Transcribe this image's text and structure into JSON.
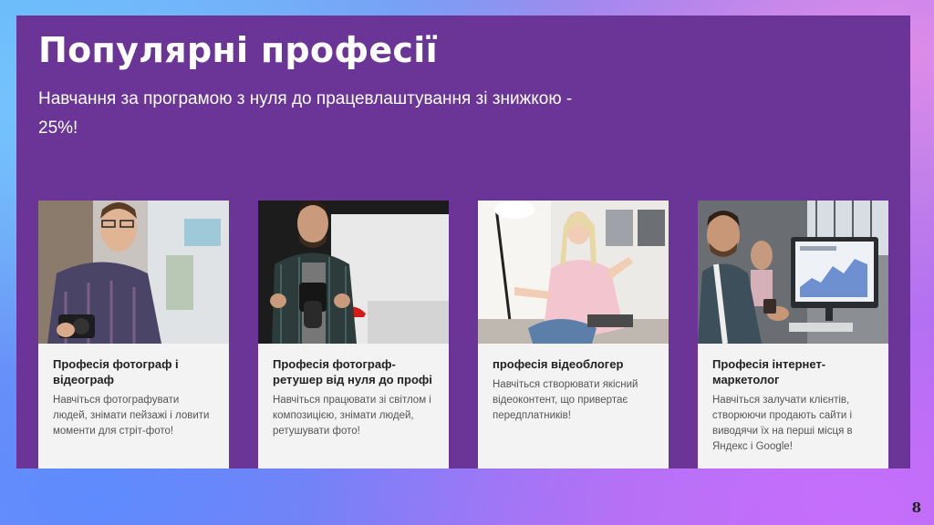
{
  "slide": {
    "title": "Популярні професії",
    "subtitle": "Навчання за програмою з нуля до працевлаштування зі знижкою - 25%!",
    "page_number": "8"
  },
  "cards": [
    {
      "title": "Професія фотограф і відеограф",
      "text": "Навчіться фотографувати людей, знімати пейзажі і ловити моменти для стріт-фото!",
      "image": "photographer-with-camera-photo"
    },
    {
      "title": "Професія фотограф-ретушер від нуля до профі",
      "text": "Навчіться працювати зі світлом і композицією, знімати людей, ретушувати фото!",
      "image": "photographer-in-studio-photo"
    },
    {
      "title": "професія відеоблогер",
      "text": "Навчіться створювати якісний відеоконтент, що привертає передплатників!",
      "image": "woman-video-blogger-photo"
    },
    {
      "title": "Професія інтернет-маркетолог",
      "text": "Навчіться залучати клієнтів, створюючи продають сайти і виводячи їх на перші місця в Яндекс і Google!",
      "image": "man-at-computer-photo"
    }
  ]
}
